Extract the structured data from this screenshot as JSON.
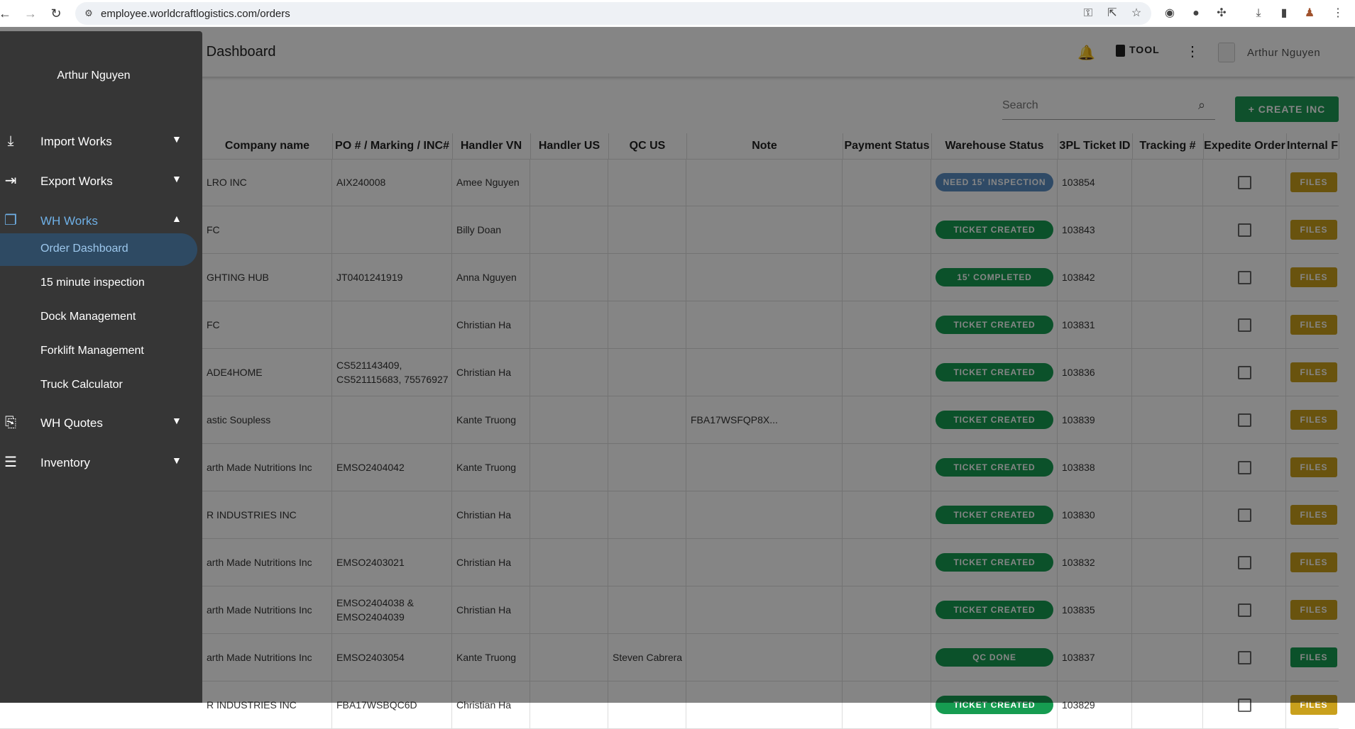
{
  "browser": {
    "url": "employee.worldcraftlogistics.com/orders",
    "nav_icons": [
      "arrow-left-icon",
      "arrow-right-icon",
      "reload-icon"
    ]
  },
  "appbar": {
    "title": "Order Dashboard",
    "tool_label": "TOOL",
    "user_name": "Arthur Nguyen"
  },
  "search": {
    "placeholder": "Search"
  },
  "create_button": {
    "label": "+ CREATE INC"
  },
  "table": {
    "columns": [
      "Company name",
      "PO # / Marking / INC#",
      "Handler VN",
      "Handler US",
      "QC US",
      "Note",
      "Payment Status",
      "Warehouse Status",
      "3PL Ticket ID",
      "Tracking #",
      "Expedite Order",
      "Internal F"
    ],
    "files_label": "FILES",
    "rows": [
      {
        "company": "LRO INC",
        "po": "AIX240008",
        "handler_vn": "Amee Nguyen",
        "handler_us": "",
        "qc_us": "",
        "note": "",
        "payment": "",
        "status": "NEED 15' INSPECTION",
        "status_color": "#5b8fc4",
        "ticket": "103854",
        "tracking": "",
        "files_color": "#c9a01c"
      },
      {
        "company": "FC",
        "po": "",
        "handler_vn": "Billy Doan",
        "handler_us": "",
        "qc_us": "",
        "note": "",
        "payment": "",
        "status": "TICKET CREATED",
        "status_color": "#169c51",
        "ticket": "103843",
        "tracking": "",
        "files_color": "#c9a01c"
      },
      {
        "company": "GHTING HUB",
        "po": "JT0401241919",
        "handler_vn": "Anna Nguyen",
        "handler_us": "",
        "qc_us": "",
        "note": "",
        "payment": "",
        "status": "15' COMPLETED",
        "status_color": "#169c51",
        "ticket": "103842",
        "tracking": "",
        "files_color": "#c9a01c"
      },
      {
        "company": "FC",
        "po": "",
        "handler_vn": "Christian Ha",
        "handler_us": "",
        "qc_us": "",
        "note": "",
        "payment": "",
        "status": "TICKET CREATED",
        "status_color": "#169c51",
        "ticket": "103831",
        "tracking": "",
        "files_color": "#c9a01c"
      },
      {
        "company": "ADE4HOME",
        "po": "CS521143409, CS521115683, 75576927",
        "handler_vn": "Christian Ha",
        "handler_us": "",
        "qc_us": "",
        "note": "",
        "payment": "",
        "status": "TICKET CREATED",
        "status_color": "#169c51",
        "ticket": "103836",
        "tracking": "",
        "files_color": "#c9a01c"
      },
      {
        "company": "astic Soupless",
        "po": "",
        "handler_vn": "Kante Truong",
        "handler_us": "",
        "qc_us": "",
        "note": "FBA17WSFQP8X...",
        "payment": "",
        "status": "TICKET CREATED",
        "status_color": "#169c51",
        "ticket": "103839",
        "tracking": "",
        "files_color": "#c9a01c"
      },
      {
        "company": "arth Made Nutritions Inc",
        "po": "EMSO2404042",
        "handler_vn": "Kante Truong",
        "handler_us": "",
        "qc_us": "",
        "note": "",
        "payment": "",
        "status": "TICKET CREATED",
        "status_color": "#169c51",
        "ticket": "103838",
        "tracking": "",
        "files_color": "#c9a01c"
      },
      {
        "company": "R INDUSTRIES INC",
        "po": "",
        "handler_vn": "Christian Ha",
        "handler_us": "",
        "qc_us": "",
        "note": "",
        "payment": "",
        "status": "TICKET CREATED",
        "status_color": "#169c51",
        "ticket": "103830",
        "tracking": "",
        "files_color": "#c9a01c"
      },
      {
        "company": "arth Made Nutritions Inc",
        "po": "EMSO2403021",
        "handler_vn": "Christian Ha",
        "handler_us": "",
        "qc_us": "",
        "note": "",
        "payment": "",
        "status": "TICKET CREATED",
        "status_color": "#169c51",
        "ticket": "103832",
        "tracking": "",
        "files_color": "#c9a01c"
      },
      {
        "company": "arth Made Nutritions Inc",
        "po": "EMSO2404038 & EMSO2404039",
        "handler_vn": "Christian Ha",
        "handler_us": "",
        "qc_us": "",
        "note": "",
        "payment": "",
        "status": "TICKET CREATED",
        "status_color": "#169c51",
        "ticket": "103835",
        "tracking": "",
        "files_color": "#c9a01c"
      },
      {
        "company": "arth Made Nutritions Inc",
        "po": "EMSO2403054",
        "handler_vn": "Kante Truong",
        "handler_us": "",
        "qc_us": "Steven Cabrera",
        "note": "",
        "payment": "",
        "status": "QC DONE",
        "status_color": "#169c51",
        "ticket": "103837",
        "tracking": "",
        "files_color": "#169c51"
      },
      {
        "company": "R INDUSTRIES INC",
        "po": "FBA17WSBQC6D",
        "handler_vn": "Christian Ha",
        "handler_us": "",
        "qc_us": "",
        "note": "",
        "payment": "",
        "status": "TICKET CREATED",
        "status_color": "#169c51",
        "ticket": "103829",
        "tracking": "",
        "files_color": "#c9a01c"
      }
    ]
  },
  "drawer": {
    "user_name": "Arthur Nguyen",
    "menu": [
      {
        "label": "Import Works",
        "icon": "download-icon",
        "expanded": false
      },
      {
        "label": "Export Works",
        "icon": "logout-icon",
        "expanded": false
      },
      {
        "label": "WH Works",
        "icon": "library-icon",
        "expanded": true
      },
      {
        "label": "WH Quotes",
        "icon": "quote-icon",
        "expanded": false
      },
      {
        "label": "Inventory",
        "icon": "inventory-icon",
        "expanded": false
      }
    ],
    "wh_works_items": [
      "Order Dashboard",
      "15 minute inspection",
      "Dock Management",
      "Forklift Management",
      "Truck Calculator"
    ]
  },
  "colors": {
    "accent_blue": "#6fb0e6",
    "create_green": "#1e9a55",
    "drawer_bg": "#363636",
    "files_yellow": "#c9a01c"
  }
}
